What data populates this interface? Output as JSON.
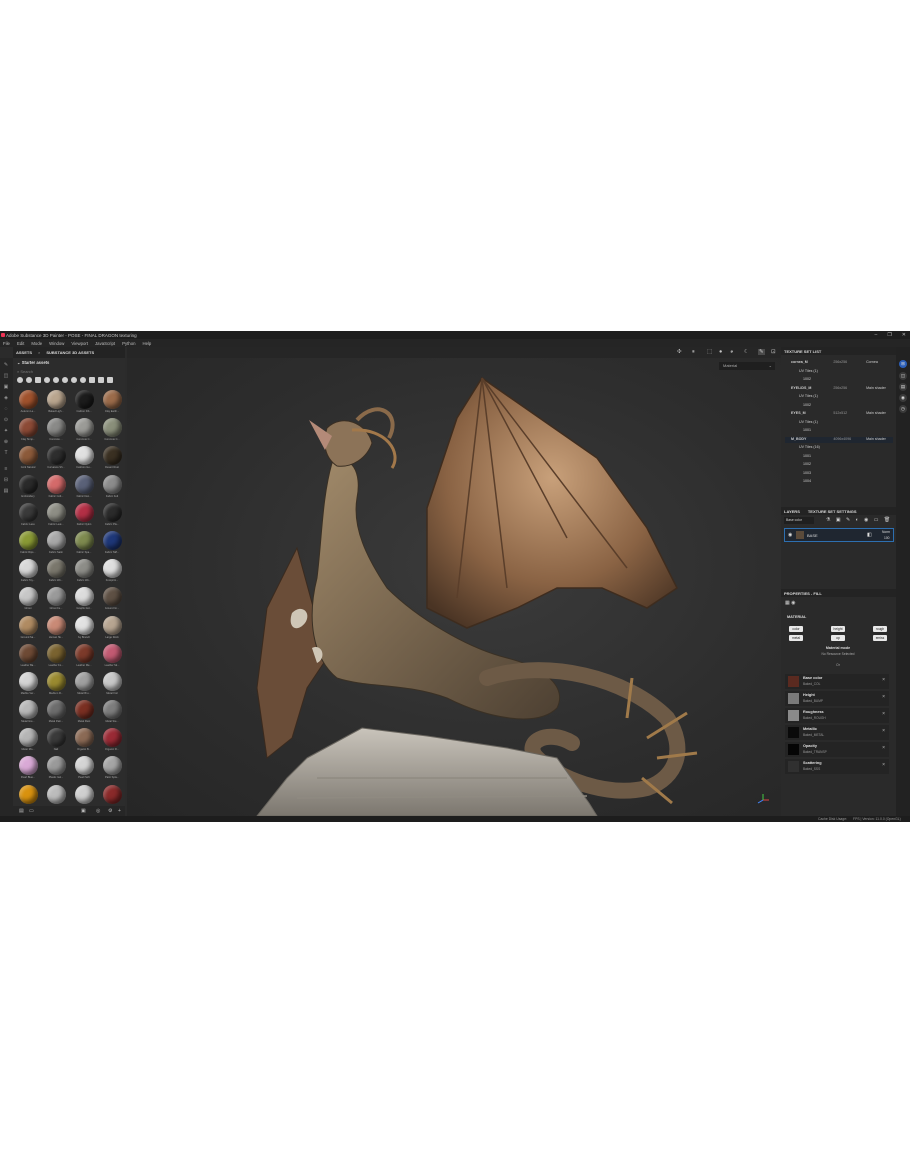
{
  "window": {
    "title": "Adobe Substance 3D Painter - POSE - FINAL DRAGON texturing"
  },
  "menu": [
    "File",
    "Edit",
    "Mode",
    "Window",
    "Viewport",
    "JavaScript",
    "Python",
    "Help"
  ],
  "assets_panel": {
    "tabs": [
      "ASSETS",
      "SUBSTANCE 3D ASSETS"
    ],
    "close_glyph": "×",
    "library": "Starter assets",
    "search_placeholder": "Search",
    "items": [
      {
        "label": "Autumn Le...",
        "color": "#a0522d"
      },
      {
        "label": "Baked Ligh...",
        "color": "#b9a58e"
      },
      {
        "label": "Carbon Fib...",
        "color": "#1c1c1c"
      },
      {
        "label": "Clay Earth...",
        "color": "#9b6b4a"
      },
      {
        "label": "Clay Simp...",
        "color": "#8c4a36"
      },
      {
        "label": "Concrete ...",
        "color": "#8a8a88"
      },
      {
        "label": "Concrete C...",
        "color": "#9b9b97"
      },
      {
        "label": "Concrete C...",
        "color": "#8a8f7a"
      },
      {
        "label": "Cork Natural",
        "color": "#8c5a3a"
      },
      {
        "label": "Curvature Sh...",
        "color": "#2e2e2e"
      },
      {
        "label": "Cushion Ge...",
        "color": "#e0e0e0"
      },
      {
        "label": "Desert Rust",
        "color": "#3a3022"
      },
      {
        "label": "Embroidery",
        "color": "#2a2a2a"
      },
      {
        "label": "Fabric Colt...",
        "color": "#d46a6a"
      },
      {
        "label": "Fabric Den...",
        "color": "#5a6178"
      },
      {
        "label": "Fabric Felt",
        "color": "#8c8c8c"
      },
      {
        "label": "Fabric Lace",
        "color": "#3a3a3a"
      },
      {
        "label": "Fabric Leat...",
        "color": "#8e8e85"
      },
      {
        "label": "Fabric Nylon",
        "color": "#b32f45"
      },
      {
        "label": "Fabric Pla...",
        "color": "#2b2b2b"
      },
      {
        "label": "Fabric Rips...",
        "color": "#8a9a35"
      },
      {
        "label": "Fabric Satin",
        "color": "#a8a8a8"
      },
      {
        "label": "Fabric Spa...",
        "color": "#7e8a4f"
      },
      {
        "label": "Fabric Taff...",
        "color": "#1e3778"
      },
      {
        "label": "Fabric Toy...",
        "color": "#d8d8d8"
      },
      {
        "label": "Fabric Wo...",
        "color": "#7a776c"
      },
      {
        "label": "Fabric Wo...",
        "color": "#8d8d88"
      },
      {
        "label": "Footprint...",
        "color": "#dedede"
      },
      {
        "label": "Ghost",
        "color": "#c7c7c7"
      },
      {
        "label": "Ghost Fe...",
        "color": "#9a9a9a"
      },
      {
        "label": "Graphic Ed...",
        "color": "#dcdcdc"
      },
      {
        "label": "Ground Gr...",
        "color": "#5e5044"
      },
      {
        "label": "Ground Sa...",
        "color": "#b08b62"
      },
      {
        "label": "Human Sk...",
        "color": "#c98a76"
      },
      {
        "label": "Ivy Branch",
        "color": "#e2e2e2"
      },
      {
        "label": "Large Rock",
        "color": "#b7a591"
      },
      {
        "label": "Leather Ba...",
        "color": "#6e4a35"
      },
      {
        "label": "Leather Fo...",
        "color": "#7a6330"
      },
      {
        "label": "Leather Me...",
        "color": "#7c3a2a"
      },
      {
        "label": "Leather Sk...",
        "color": "#c25a72"
      },
      {
        "label": "Marble Ver...",
        "color": "#d4d4d4"
      },
      {
        "label": "Medium R...",
        "color": "#9a8a30"
      },
      {
        "label": "Metal Bru...",
        "color": "#a0a0a0"
      },
      {
        "label": "Metal Foil",
        "color": "#c8c8c8"
      },
      {
        "label": "Metal Gre...",
        "color": "#b8b8b8"
      },
      {
        "label": "Metal Pain...",
        "color": "#6d6d6d"
      },
      {
        "label": "Metal Rust",
        "color": "#7a2f22"
      },
      {
        "label": "Metal Ste...",
        "color": "#7d7d7d"
      },
      {
        "label": "Meter Mo...",
        "color": "#b5b5b5"
      },
      {
        "label": "Nail",
        "color": "#3a3a3a"
      },
      {
        "label": "Organic B...",
        "color": "#8b6a55"
      },
      {
        "label": "Organic Fl...",
        "color": "#9a2a35"
      },
      {
        "label": "Pearl Blue...",
        "color": "#d9a9d6"
      },
      {
        "label": "Plastic Gel...",
        "color": "#9a9a9a"
      },
      {
        "label": "Pearl Soft",
        "color": "#d4d4d4"
      },
      {
        "label": "Paint Spla...",
        "color": "#a5a5a5"
      },
      {
        "label": "",
        "color": "#d9920f"
      },
      {
        "label": "",
        "color": "#bcbcbc"
      },
      {
        "label": "",
        "color": "#cfcfcf"
      },
      {
        "label": "",
        "color": "#8a2a2a"
      }
    ]
  },
  "viewport": {
    "material_mode": "Material"
  },
  "texture_set_list": {
    "title": "TEXTURE SET LIST",
    "rows": [
      {
        "name": "cornea_M",
        "res": "256x256",
        "shader": "Cornea"
      },
      {
        "name": "UV Tiles (1)",
        "res": "",
        "shader": ""
      },
      {
        "name": "1002",
        "res": "",
        "shader": ""
      },
      {
        "name": "EYELIDS_M",
        "res": "256x256",
        "shader": "Main shader"
      },
      {
        "name": "UV Tiles (1)",
        "res": "",
        "shader": ""
      },
      {
        "name": "1002",
        "res": "",
        "shader": ""
      },
      {
        "name": "EYES_M",
        "res": "512x512",
        "shader": "Main shader"
      },
      {
        "name": "UV Tiles (1)",
        "res": "",
        "shader": ""
      },
      {
        "name": "1001",
        "res": "",
        "shader": ""
      },
      {
        "name": "M_BODY",
        "res": "4096x4096",
        "shader": "Main shader"
      },
      {
        "name": "UV Tiles (16)",
        "res": "",
        "shader": ""
      },
      {
        "name": "1001",
        "res": "",
        "shader": ""
      },
      {
        "name": "1002",
        "res": "",
        "shader": ""
      },
      {
        "name": "1003",
        "res": "",
        "shader": ""
      },
      {
        "name": "1004",
        "res": "",
        "shader": ""
      }
    ]
  },
  "layers": {
    "tabs": [
      "LAYERS",
      "TEXTURE SET SETTINGS"
    ],
    "channel": "Base color",
    "layer_name": "BASE",
    "blend": "Norm",
    "opacity": "100"
  },
  "properties": {
    "title": "PROPERTIES - FILL",
    "section": "MATERIAL",
    "chips": [
      "color",
      "height",
      "rough",
      "metal",
      "op",
      "emiss"
    ],
    "material_mode": "Material mode",
    "no_resource": "No Resource Selected",
    "or": "Or",
    "channels": [
      {
        "name": "Base color",
        "sub": "Baked_COL",
        "color": "#5a2a20"
      },
      {
        "name": "Height",
        "sub": "Baked_BUMP",
        "color": "#7a7a7a"
      },
      {
        "name": "Roughness",
        "sub": "Baked_ROUGH",
        "color": "#8a8a8a"
      },
      {
        "name": "Metallic",
        "sub": "Baked_METAL",
        "color": "#0a0a0a"
      },
      {
        "name": "Opacity",
        "sub": "Baked_TRANSP",
        "color": "#050505"
      },
      {
        "name": "Scattering",
        "sub": "Baked_SSS",
        "color": "#303030"
      }
    ]
  },
  "statusbar": {
    "cache": "Cache Disk Usage:",
    "version": "FPS | Version: 11.0.0 (OpenGL)"
  }
}
